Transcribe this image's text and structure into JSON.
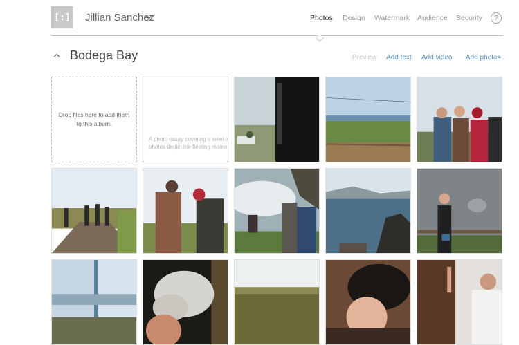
{
  "header": {
    "logo_glyph": "[:]",
    "user_name": "Jillian Sanchez",
    "nav": [
      {
        "label": "Photos",
        "active": true
      },
      {
        "label": "Design",
        "active": false
      },
      {
        "label": "Watermark",
        "active": false
      },
      {
        "label": "Audience",
        "active": false
      },
      {
        "label": "Security",
        "active": false
      }
    ],
    "help_label": "?"
  },
  "album": {
    "title": "Bodega Bay",
    "actions": {
      "preview": "Preview",
      "add_text": "Add text",
      "add_video": "Add video",
      "add_photos": "Add photos"
    }
  },
  "grid": {
    "drop_zone_text": "Drop files here to add them to this album.",
    "essay_text_line1": "A photo essay covering a weeke",
    "essay_text_line2": "photos depict the fleeting mome"
  },
  "colors": {
    "accent_link": "#5b93c4",
    "disabled": "#c4c4c4",
    "divider": "#bdbdbd",
    "logo_bg": "#c9c9c9"
  }
}
